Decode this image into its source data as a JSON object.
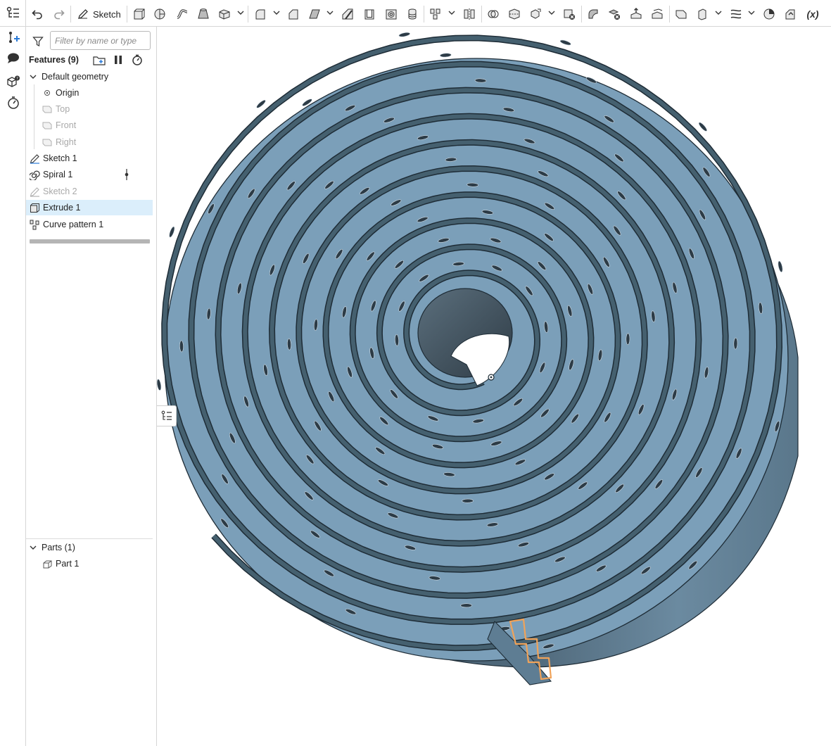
{
  "toolbar": {
    "undo_icon": "undo-icon",
    "redo_icon": "redo-icon",
    "sketch_label": "Sketch",
    "tools": [
      "extrude-icon",
      "revolve-icon",
      "sweep-icon",
      "loft-icon",
      "thicken-icon",
      "fillet-icon",
      "chamfer-icon",
      "draft-icon",
      "rib-icon",
      "shell-icon",
      "hole-icon",
      "helix-icon",
      "pattern-icon",
      "mirror-icon",
      "boolean-icon",
      "split-icon",
      "transform-icon",
      "delete-part-icon",
      "modify-fillet-icon",
      "delete-face-icon",
      "move-face-icon",
      "replace-face-icon",
      "plane-icon",
      "mate-connector-icon",
      "variable-icon"
    ],
    "variable_label": "(x)"
  },
  "rail": {
    "icons": [
      "feature-list-icon",
      "add-feature-icon",
      "comments-icon",
      "parts-icon",
      "timer-icon"
    ]
  },
  "panel": {
    "filter_placeholder": "Filter by name or type",
    "features_title": "Features (9)",
    "default_geometry": "Default geometry",
    "origin": "Origin",
    "planes": [
      "Top",
      "Front",
      "Right"
    ],
    "features": [
      {
        "label": "Sketch 1",
        "icon": "sketch-icon",
        "dim": false,
        "selected": false
      },
      {
        "label": "Spiral 1",
        "icon": "spiral-icon",
        "dim": false,
        "selected": false
      },
      {
        "label": "Sketch 2",
        "icon": "sketch-icon",
        "dim": true,
        "selected": false
      },
      {
        "label": "Extrude 1",
        "icon": "extrude-icon",
        "dim": false,
        "selected": true
      },
      {
        "label": "Curve pattern 1",
        "icon": "curve-pattern-icon",
        "dim": false,
        "selected": false
      }
    ],
    "parts_title": "Parts (1)",
    "parts": [
      "Part 1"
    ]
  },
  "colors": {
    "model_top": "#7b9fb9",
    "model_side": "#4d6779",
    "model_edge": "#1e2c36",
    "selection": "#f0a35a",
    "selected_row": "#dbeefb"
  }
}
